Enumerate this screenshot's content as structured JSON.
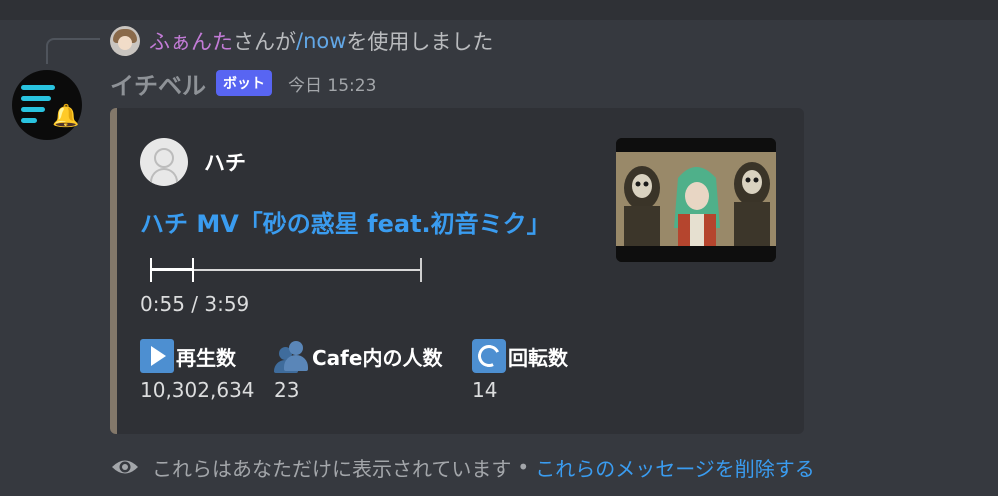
{
  "reply": {
    "user": "ふぁんた",
    "text_before": "さんが",
    "command": "/now",
    "text_after": "を使用しました"
  },
  "message": {
    "username": "イチベル",
    "badge": "ボット",
    "timestamp": "今日 15:23"
  },
  "embed": {
    "accent_color": "#83786a",
    "author": "ハチ",
    "title": "ハチ MV「砂の惑星 feat.初音ミク」",
    "progress_fraction": 0.155,
    "time": "0:55 / 3:59",
    "fields": [
      {
        "icon": "play-button-icon",
        "name": "再生数",
        "value": "10,302,634"
      },
      {
        "icon": "users-icon",
        "name": "Cafe内の人数",
        "value": "23"
      },
      {
        "icon": "repeat-icon",
        "name": "回転数",
        "value": "14"
      }
    ]
  },
  "footer": {
    "notice": "これらはあなただけに表示されています",
    "dot": "•",
    "link": "これらのメッセージを削除する"
  }
}
